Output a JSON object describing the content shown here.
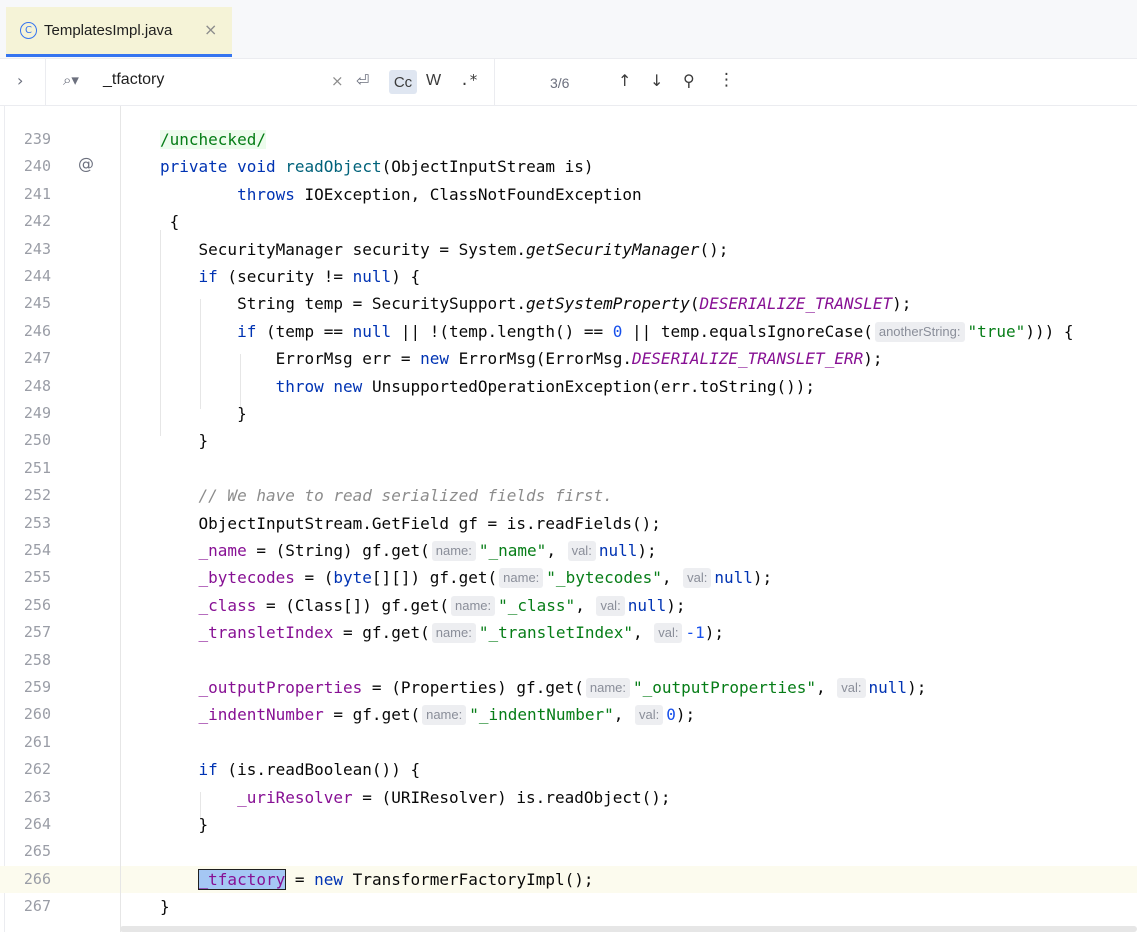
{
  "tab": {
    "icon": "class-icon",
    "icon_glyph": "C",
    "name": "TemplatesImpl.java",
    "close_glyph": "×"
  },
  "find": {
    "expand_glyph": "›",
    "search_glyph": "⌕▾",
    "query": "_tfactory",
    "clear_glyph": "×",
    "newline_glyph": "⏎",
    "match_case_label": "Cc",
    "words_label": "W",
    "regex_label": ".*",
    "count": "3/6",
    "prev_glyph": "↑",
    "next_glyph": "↓",
    "filter_glyph": "⚲",
    "more_glyph": "⋮"
  },
  "gutter_marker": "@",
  "colors": {
    "keyword": "#0033b3",
    "method": "#00627a",
    "field": "#871094",
    "string": "#067d17",
    "number": "#1750eb",
    "comment": "#8c8c8c",
    "accent": "#3574f0"
  },
  "lines": [
    {
      "n": "239",
      "t": [
        {
          "c": "a",
          "v": "/unchecked/"
        }
      ]
    },
    {
      "n": "240",
      "t": [
        {
          "c": "k",
          "v": "private"
        },
        {
          "v": " "
        },
        {
          "c": "k",
          "v": "void"
        },
        {
          "v": " "
        },
        {
          "c": "m",
          "v": "readObject"
        },
        {
          "v": "(ObjectInputStream is)"
        }
      ]
    },
    {
      "n": "241",
      "t": [
        {
          "v": "        "
        },
        {
          "c": "k",
          "v": "throws"
        },
        {
          "v": " IOException, ClassNotFoundException"
        }
      ]
    },
    {
      "n": "242",
      "t": [
        {
          "v": " {"
        }
      ]
    },
    {
      "n": "243",
      "t": [
        {
          "v": "    SecurityManager security = System."
        },
        {
          "c": "i",
          "v": "getSecurityManager"
        },
        {
          "v": "();"
        }
      ]
    },
    {
      "n": "244",
      "t": [
        {
          "v": "    "
        },
        {
          "c": "k",
          "v": "if"
        },
        {
          "v": " (security != "
        },
        {
          "c": "k",
          "v": "null"
        },
        {
          "v": ") {"
        }
      ]
    },
    {
      "n": "245",
      "t": [
        {
          "v": "        String temp = SecuritySupport."
        },
        {
          "c": "i",
          "v": "getSystemProperty"
        },
        {
          "v": "("
        },
        {
          "c": "cf",
          "v": "DESERIALIZE_TRANSLET"
        },
        {
          "v": ");"
        }
      ]
    },
    {
      "n": "246",
      "t": [
        {
          "v": "        "
        },
        {
          "c": "k",
          "v": "if"
        },
        {
          "v": " (temp == "
        },
        {
          "c": "k",
          "v": "null"
        },
        {
          "v": " || !(temp.length() == "
        },
        {
          "c": "n",
          "v": "0"
        },
        {
          "v": " || temp.equalsIgnoreCase("
        },
        {
          "c": "h",
          "v": "anotherString:"
        },
        {
          "c": "s",
          "v": "\"true\""
        },
        {
          "v": "))) {"
        }
      ]
    },
    {
      "n": "247",
      "t": [
        {
          "v": "            ErrorMsg err = "
        },
        {
          "c": "k",
          "v": "new"
        },
        {
          "v": " ErrorMsg(ErrorMsg."
        },
        {
          "c": "cf",
          "v": "DESERIALIZE_TRANSLET_ERR"
        },
        {
          "v": ");"
        }
      ]
    },
    {
      "n": "248",
      "t": [
        {
          "v": "            "
        },
        {
          "c": "k",
          "v": "throw"
        },
        {
          "v": " "
        },
        {
          "c": "k",
          "v": "new"
        },
        {
          "v": " UnsupportedOperationException(err.toString());"
        }
      ]
    },
    {
      "n": "249",
      "t": [
        {
          "v": "        }"
        }
      ]
    },
    {
      "n": "250",
      "t": [
        {
          "v": "    }"
        }
      ]
    },
    {
      "n": "251",
      "t": []
    },
    {
      "n": "252",
      "t": [
        {
          "v": "    "
        },
        {
          "c": "c",
          "v": "// We have to read serialized fields first."
        }
      ]
    },
    {
      "n": "253",
      "t": [
        {
          "v": "    ObjectInputStream.GetField gf = is.readFields();"
        }
      ]
    },
    {
      "n": "254",
      "t": [
        {
          "v": "    "
        },
        {
          "c": "f",
          "v": "_name"
        },
        {
          "v": " = (String) gf.get("
        },
        {
          "c": "h",
          "v": "name:"
        },
        {
          "c": "s",
          "v": "\"_name\""
        },
        {
          "v": ", "
        },
        {
          "c": "h",
          "v": "val:"
        },
        {
          "c": "k",
          "v": "null"
        },
        {
          "v": ");"
        }
      ]
    },
    {
      "n": "255",
      "t": [
        {
          "v": "    "
        },
        {
          "c": "f",
          "v": "_bytecodes"
        },
        {
          "v": " = ("
        },
        {
          "c": "k",
          "v": "byte"
        },
        {
          "v": "[][]) gf.get("
        },
        {
          "c": "h",
          "v": "name:"
        },
        {
          "c": "s",
          "v": "\"_bytecodes\""
        },
        {
          "v": ", "
        },
        {
          "c": "h",
          "v": "val:"
        },
        {
          "c": "k",
          "v": "null"
        },
        {
          "v": ");"
        }
      ]
    },
    {
      "n": "256",
      "t": [
        {
          "v": "    "
        },
        {
          "c": "f",
          "v": "_class"
        },
        {
          "v": " = (Class[]) gf.get("
        },
        {
          "c": "h",
          "v": "name:"
        },
        {
          "c": "s",
          "v": "\"_class\""
        },
        {
          "v": ", "
        },
        {
          "c": "h",
          "v": "val:"
        },
        {
          "c": "k",
          "v": "null"
        },
        {
          "v": ");"
        }
      ]
    },
    {
      "n": "257",
      "t": [
        {
          "v": "    "
        },
        {
          "c": "f",
          "v": "_transletIndex"
        },
        {
          "v": " = gf.get("
        },
        {
          "c": "h",
          "v": "name:"
        },
        {
          "c": "s",
          "v": "\"_transletIndex\""
        },
        {
          "v": ", "
        },
        {
          "c": "h",
          "v": "val:"
        },
        {
          "c": "n",
          "v": "-1"
        },
        {
          "v": ");"
        }
      ]
    },
    {
      "n": "258",
      "t": []
    },
    {
      "n": "259",
      "t": [
        {
          "v": "    "
        },
        {
          "c": "f",
          "v": "_outputProperties"
        },
        {
          "v": " = (Properties) gf.get("
        },
        {
          "c": "h",
          "v": "name:"
        },
        {
          "c": "s",
          "v": "\"_outputProperties\""
        },
        {
          "v": ", "
        },
        {
          "c": "h",
          "v": "val:"
        },
        {
          "c": "k",
          "v": "null"
        },
        {
          "v": ");"
        }
      ]
    },
    {
      "n": "260",
      "t": [
        {
          "v": "    "
        },
        {
          "c": "f",
          "v": "_indentNumber"
        },
        {
          "v": " = gf.get("
        },
        {
          "c": "h",
          "v": "name:"
        },
        {
          "c": "s",
          "v": "\"_indentNumber\""
        },
        {
          "v": ", "
        },
        {
          "c": "h",
          "v": "val:"
        },
        {
          "c": "n",
          "v": "0"
        },
        {
          "v": ");"
        }
      ]
    },
    {
      "n": "261",
      "t": []
    },
    {
      "n": "262",
      "t": [
        {
          "v": "    "
        },
        {
          "c": "k",
          "v": "if"
        },
        {
          "v": " (is.readBoolean()) {"
        }
      ]
    },
    {
      "n": "263",
      "t": [
        {
          "v": "        "
        },
        {
          "c": "f",
          "v": "_uriResolver"
        },
        {
          "v": " = (URIResolver) is.readObject();"
        }
      ]
    },
    {
      "n": "264",
      "t": [
        {
          "v": "    }"
        }
      ]
    },
    {
      "n": "265",
      "t": []
    },
    {
      "n": "266",
      "t": [
        {
          "v": "    "
        },
        {
          "c": "fm",
          "v": "_tfactory"
        },
        {
          "v": " = "
        },
        {
          "c": "k",
          "v": "new"
        },
        {
          "v": " TransformerFactoryImpl();"
        }
      ]
    },
    {
      "n": "267",
      "t": [
        {
          "v": "}"
        }
      ]
    }
  ]
}
